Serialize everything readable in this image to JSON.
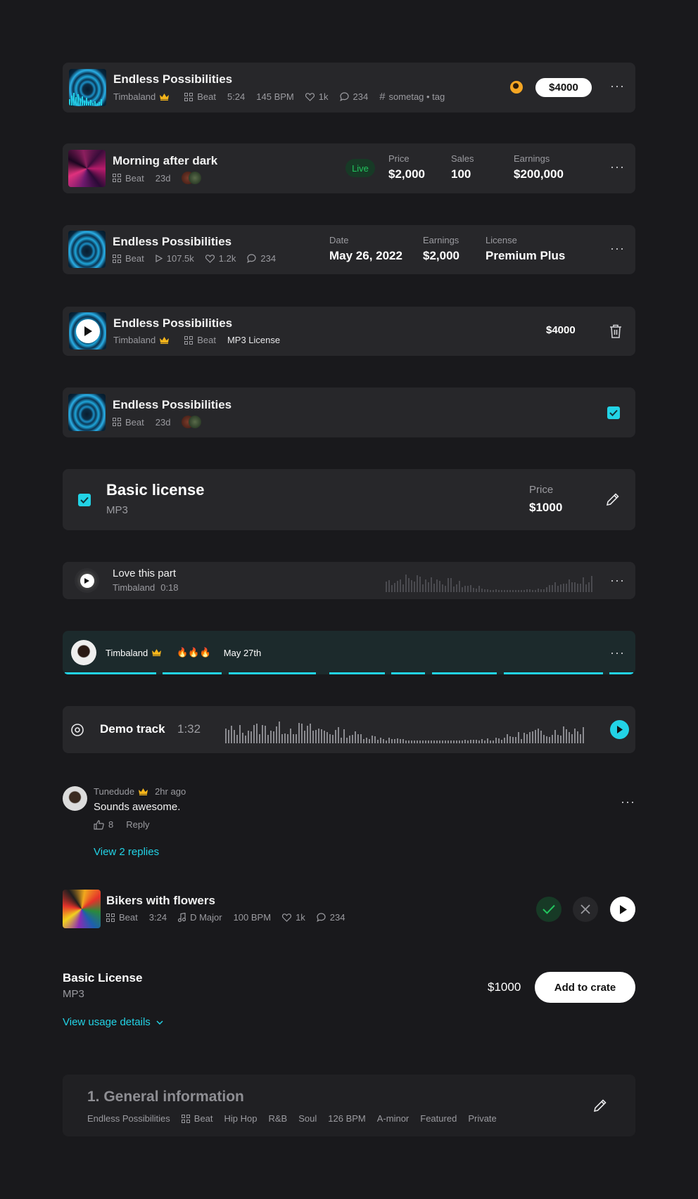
{
  "colors": {
    "background": "#19191c",
    "card": "#27272a",
    "accent": "#22d3e6",
    "crown": "#f5b51b",
    "live_green": "#22c55e"
  },
  "card1": {
    "title": "Endless Possibilities",
    "artist": "Timbaland",
    "type": "Beat",
    "duration": "5:24",
    "bpm": "145 BPM",
    "likes": "1k",
    "comments": "234",
    "tags": "sometag • tag",
    "price": "$4000"
  },
  "card2": {
    "title": "Morning after dark",
    "type": "Beat",
    "age": "23d",
    "status": "Live",
    "price_label": "Price",
    "price": "$2,000",
    "sales_label": "Sales",
    "sales": "100",
    "earnings_label": "Earnings",
    "earnings": "$200,000"
  },
  "card3": {
    "title": "Endless Possibilities",
    "type": "Beat",
    "plays": "107.5k",
    "likes": "1.2k",
    "comments": "234",
    "date_label": "Date",
    "date": "May 26, 2022",
    "earnings_label": "Earnings",
    "earnings": "$2,000",
    "license_label": "License",
    "license": "Premium Plus"
  },
  "card4": {
    "title": "Endless Possibilities",
    "artist": "Timbaland",
    "type": "Beat",
    "license": "MP3 License",
    "price": "$4000"
  },
  "card5": {
    "title": "Endless Possibilities",
    "type": "Beat",
    "age": "23d"
  },
  "card6": {
    "title": "Basic license",
    "format": "MP3",
    "price_label": "Price",
    "price": "$1000"
  },
  "card7": {
    "title": "Love this part",
    "artist": "Timbaland",
    "time": "0:18"
  },
  "card8": {
    "artist": "Timbaland",
    "emojis": "🔥🔥🔥",
    "date": "May 27th"
  },
  "card9": {
    "title": "Demo track",
    "duration": "1:32"
  },
  "comment": {
    "user": "Tunedude",
    "time": "2hr ago",
    "text": "Sounds awesome.",
    "likes": "8",
    "reply": "Reply",
    "view_replies": "View 2 replies"
  },
  "card10": {
    "title": "Bikers with flowers",
    "type": "Beat",
    "duration": "3:24",
    "key": "D Major",
    "bpm": "100 BPM",
    "likes": "1k",
    "comments": "234"
  },
  "license": {
    "title": "Basic License",
    "format": "MP3",
    "price": "$1000",
    "button": "Add to crate",
    "details": "View usage details"
  },
  "general": {
    "title": "1. General information",
    "tags": [
      "Endless Possibilities",
      "Beat",
      "Hip Hop",
      "R&B",
      "Soul",
      "126 BPM",
      "A-minor",
      "Featured",
      "Private"
    ]
  }
}
